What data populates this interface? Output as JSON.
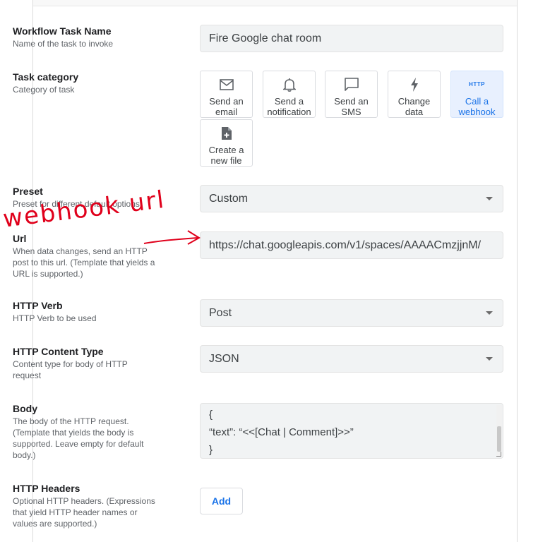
{
  "fields": {
    "task_name": {
      "label": "Workflow Task Name",
      "desc": "Name of the task to invoke",
      "value": "Fire Google chat room"
    },
    "task_category": {
      "label": "Task category",
      "desc": "Category of task",
      "options": [
        {
          "line1": "Send an",
          "line2": "email",
          "icon": "mail-icon"
        },
        {
          "line1": "Send a",
          "line2": "notification",
          "icon": "bell-icon"
        },
        {
          "line1": "Send an",
          "line2": "SMS",
          "icon": "chat-bubble-icon"
        },
        {
          "line1": "Change",
          "line2": "data",
          "icon": "lightning-icon"
        },
        {
          "line1": "Call a",
          "line2": "webhook",
          "icon": "http-icon",
          "icon_text": "HTTP",
          "selected": true
        },
        {
          "line1": "Create a",
          "line2": "new file",
          "icon": "new-file-icon"
        }
      ]
    },
    "preset": {
      "label": "Preset",
      "desc": "Preset for different default options",
      "value": "Custom"
    },
    "url": {
      "label": "Url",
      "desc": "When data changes, send an HTTP post to this url. (Template that yields a URL is supported.)",
      "value": "https://chat.googleapis.com/v1/spaces/AAAACmzjjnM/"
    },
    "http_verb": {
      "label": "HTTP Verb",
      "desc": "HTTP Verb to be used",
      "value": "Post"
    },
    "content_type": {
      "label": "HTTP Content Type",
      "desc": "Content type for body of HTTP request",
      "value": "JSON"
    },
    "body": {
      "label": "Body",
      "desc": "The body of the HTTP request. (Template that yields the body is supported. Leave empty for default body.)",
      "lines": [
        "{",
        "“text”: “<<[Chat | Comment]>>”",
        "}"
      ]
    },
    "headers": {
      "label": "HTTP Headers",
      "desc": "Optional HTTP headers. (Expressions that yield HTTP header names or values are supported.)",
      "add_label": "Add"
    }
  },
  "annotation": {
    "text": "webhook url",
    "color": "#e0001b"
  },
  "colors": {
    "accent": "#1a73e8",
    "selected_bg": "#e8f0fe",
    "field_bg": "#f1f3f4"
  }
}
